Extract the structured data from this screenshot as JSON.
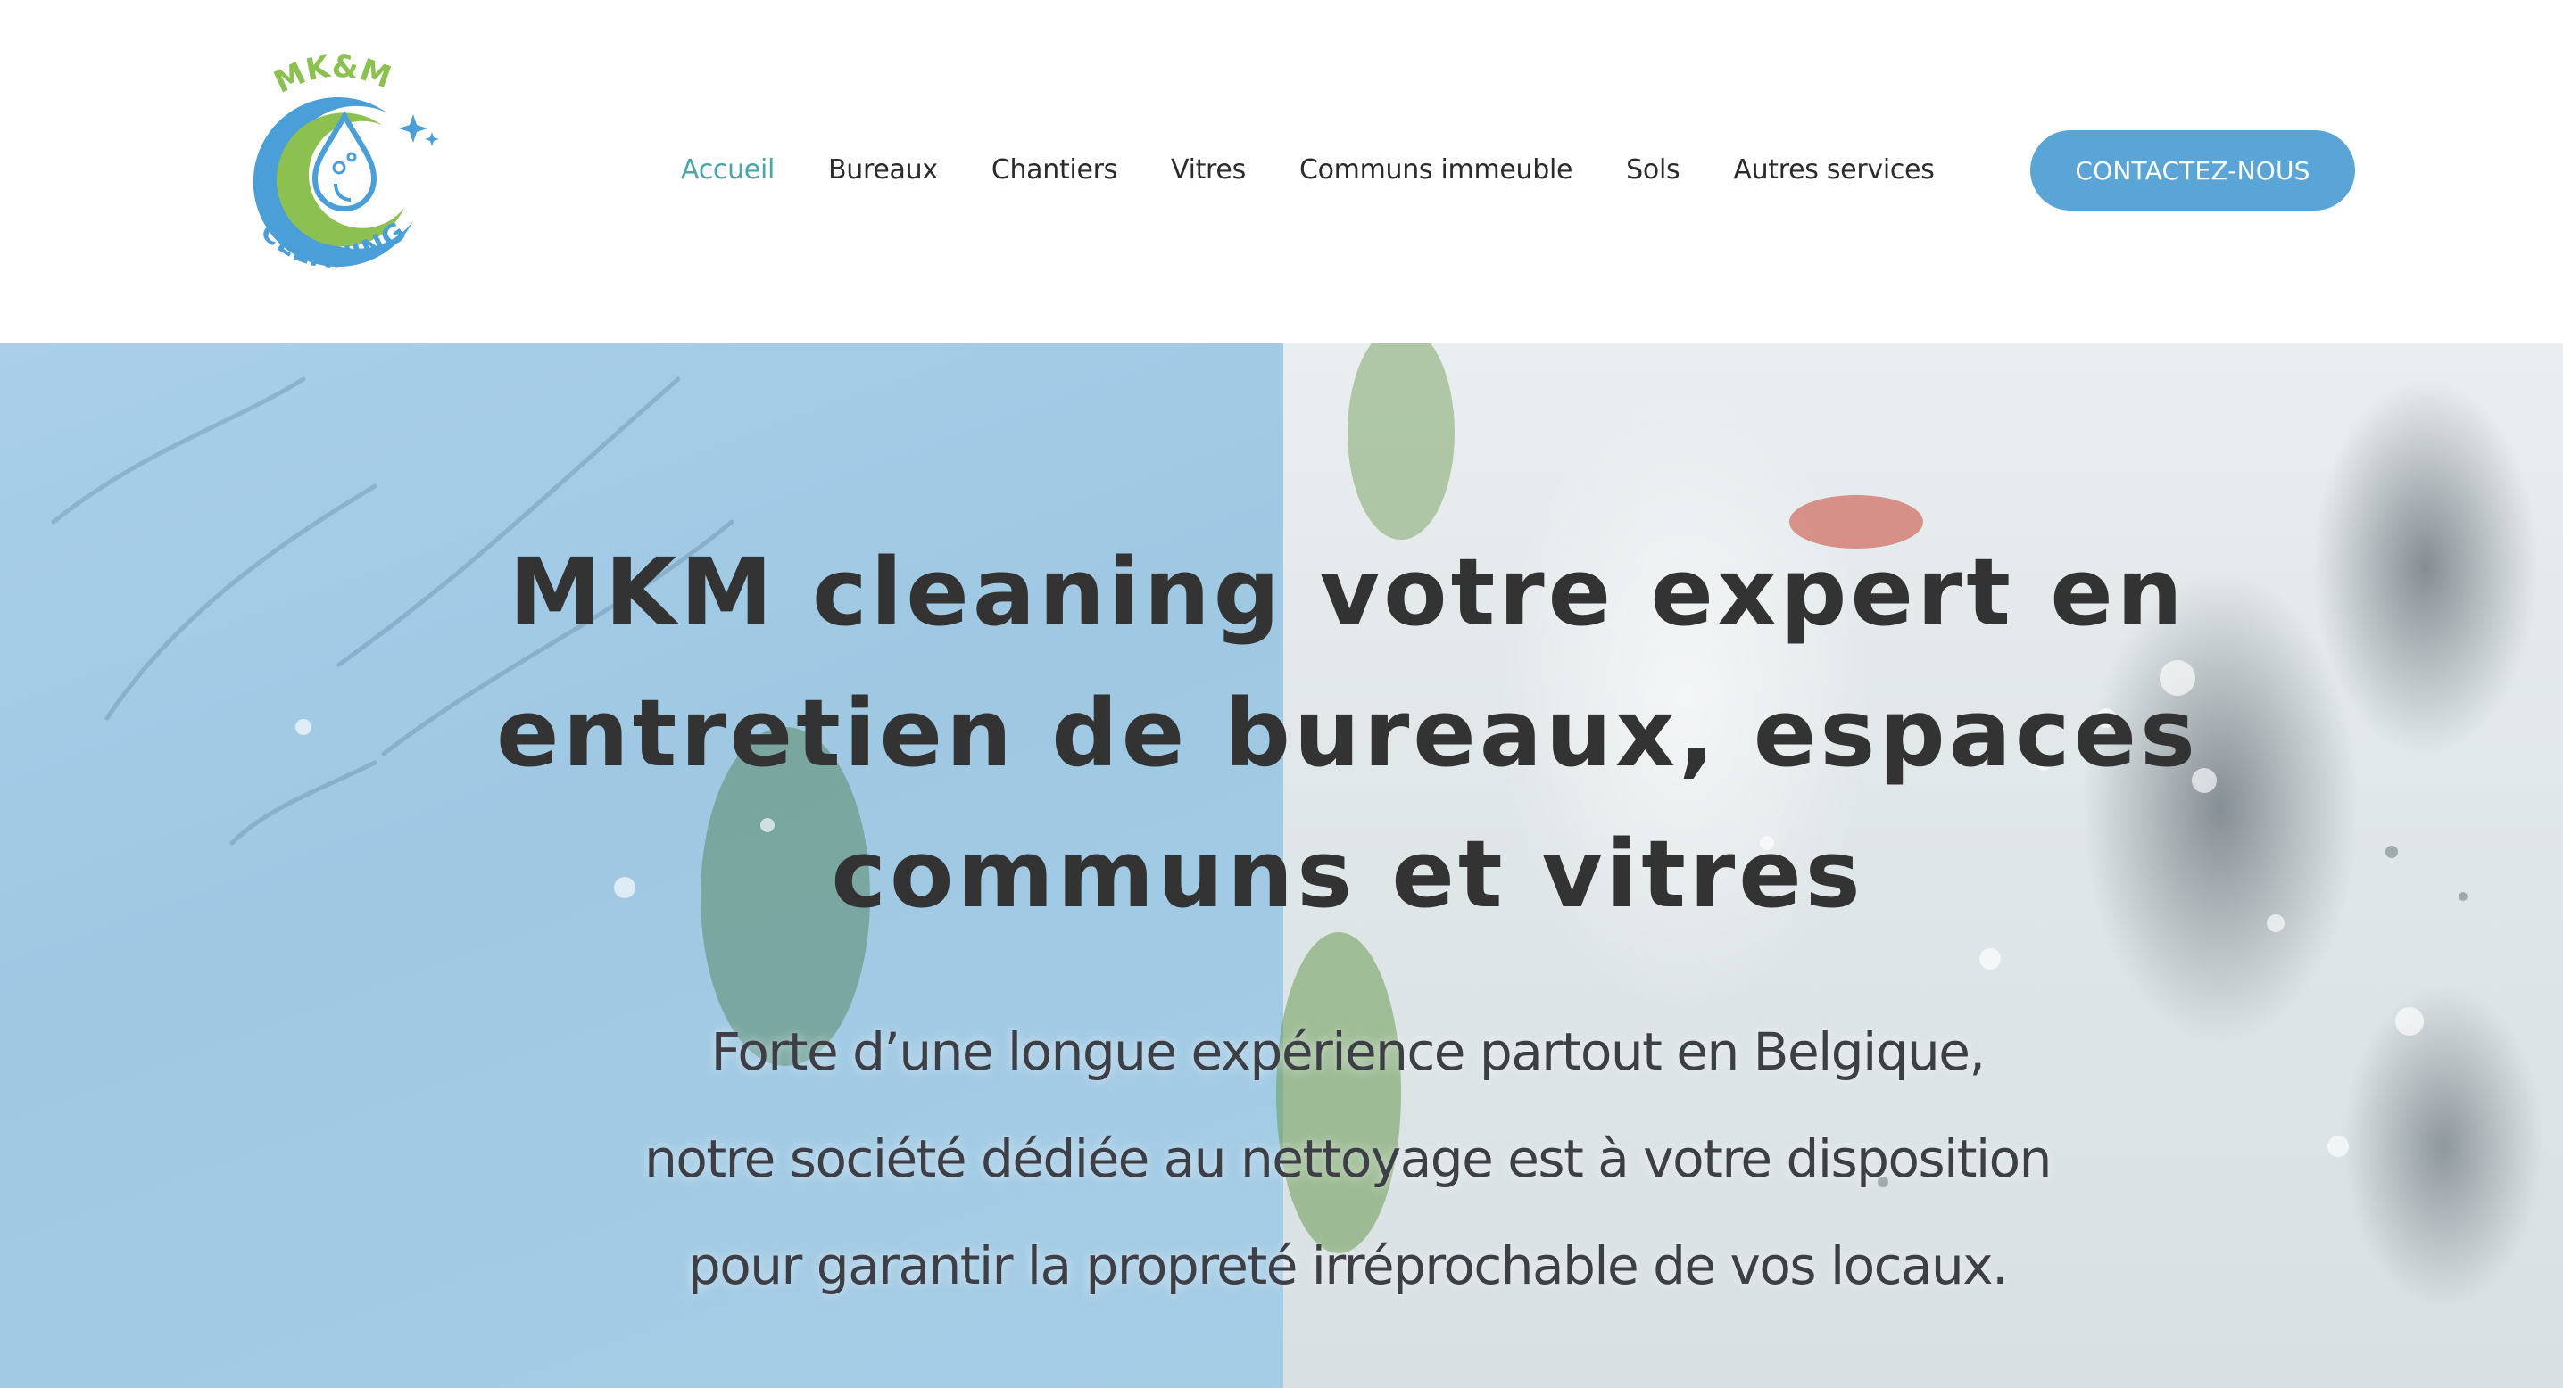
{
  "brand": {
    "logo_top_text": "MK&M",
    "logo_bottom_text": "CLEANING",
    "colors": {
      "logo_green": "#8cc152",
      "logo_blue": "#4a9fd8",
      "accent_teal": "#4aa6a8",
      "cta_blue": "#5ba4d6"
    }
  },
  "nav": {
    "items": [
      {
        "label": "Accueil",
        "active": true
      },
      {
        "label": "Bureaux",
        "active": false
      },
      {
        "label": "Chantiers",
        "active": false
      },
      {
        "label": "Vitres",
        "active": false
      },
      {
        "label": "Communs immeuble",
        "active": false
      },
      {
        "label": "Sols",
        "active": false
      },
      {
        "label": "Autres services",
        "active": false
      }
    ],
    "cta_label": "CONTACTEZ-NOUS"
  },
  "hero": {
    "title_lines": [
      "MKM cleaning votre expert en",
      "entretien de bureaux, espaces",
      "communs et vitres"
    ],
    "subtitle_lines": [
      "Forte d’une longue expérience partout en Belgique,",
      "notre société dédiée au nettoyage est à votre disposition",
      "pour garantir la propreté irréprochable de vos locaux."
    ],
    "background": {
      "left_panel_color": "#a9cfea",
      "right_panel_color": "#e3e9eb"
    }
  }
}
